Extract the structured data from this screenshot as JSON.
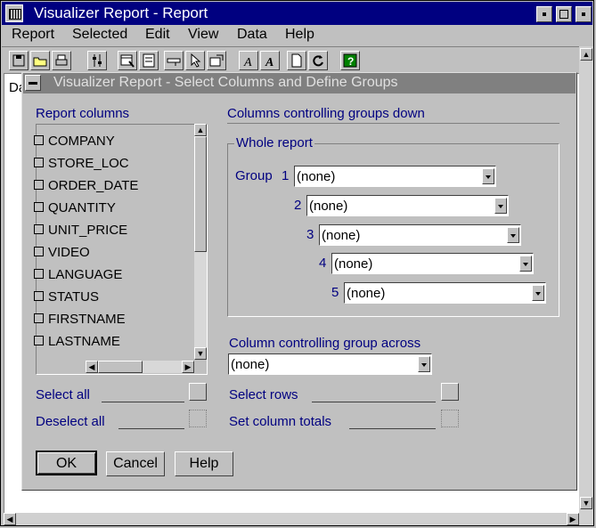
{
  "window": {
    "title": "Visualizer Report - Report"
  },
  "menu": [
    {
      "label": "Report"
    },
    {
      "label": "Selected"
    },
    {
      "label": "Edit"
    },
    {
      "label": "View"
    },
    {
      "label": "Data"
    },
    {
      "label": "Help"
    }
  ],
  "client": {
    "partial_text": "Da"
  },
  "dialog": {
    "title": "Visualizer Report - Select Columns and Define Groups",
    "report_columns_label": "Report columns",
    "columns": [
      "COMPANY",
      "STORE_LOC",
      "ORDER_DATE",
      "QUANTITY",
      "UNIT_PRICE",
      "VIDEO",
      "LANGUAGE",
      "STATUS",
      "FIRSTNAME",
      "LASTNAME"
    ],
    "groups_down_label": "Columns controlling groups down",
    "whole_report_label": "Whole report",
    "group_label": "Group",
    "groups": [
      {
        "num": "1",
        "value": "(none)"
      },
      {
        "num": "2",
        "value": "(none)"
      },
      {
        "num": "3",
        "value": "(none)"
      },
      {
        "num": "4",
        "value": "(none)"
      },
      {
        "num": "5",
        "value": "(none)"
      }
    ],
    "group_across_label": "Column controlling group across",
    "group_across_value": "(none)",
    "select_all": "Select all",
    "deselect_all": "Deselect all",
    "select_rows": "Select rows",
    "set_column_totals": "Set column totals",
    "ok": "OK",
    "cancel": "Cancel",
    "help": "Help"
  }
}
